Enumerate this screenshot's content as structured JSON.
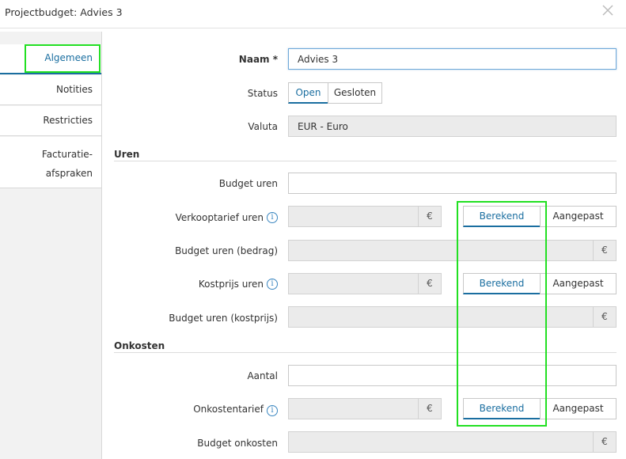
{
  "window": {
    "title": "Projectbudget: Advies 3"
  },
  "sidebar": {
    "items": [
      {
        "label": "Algemeen"
      },
      {
        "label": "Notities"
      },
      {
        "label": "Restricties"
      },
      {
        "label_line1": "Facturatie-",
        "label_line2": "afspraken"
      }
    ]
  },
  "form": {
    "naam_label": "Naam *",
    "naam_value": "Advies 3",
    "status_label": "Status",
    "status_options": [
      "Open",
      "Gesloten"
    ],
    "status_selected": "Open",
    "valuta_label": "Valuta",
    "valuta_value": "EUR - Euro"
  },
  "uren": {
    "heading": "Uren",
    "budget_uren_label": "Budget uren",
    "verkooptarief_label": "Verkooptarief uren",
    "budget_bedrag_label": "Budget uren (bedrag)",
    "kostprijs_label": "Kostprijs uren",
    "budget_kostprijs_label": "Budget uren (kostprijs)"
  },
  "onkosten": {
    "heading": "Onkosten",
    "aantal_label": "Aantal",
    "onkostentarief_label": "Onkostentarief",
    "budget_onkosten_label": "Budget onkosten"
  },
  "common": {
    "currency": "€",
    "info": "i",
    "berekend": "Berekend",
    "aangepast": "Aangepast"
  },
  "colors": {
    "accent": "#1a6ea0",
    "highlight": "#22e022"
  }
}
